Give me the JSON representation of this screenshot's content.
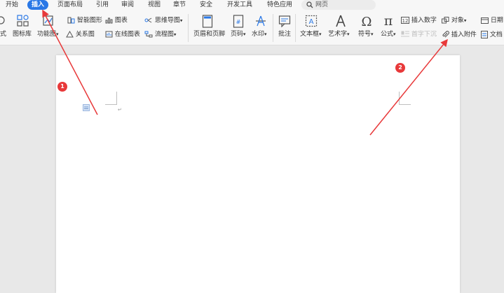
{
  "menu": {
    "tabs": [
      "开始",
      "插入",
      "页面布局",
      "引用",
      "审阅",
      "视图",
      "章节",
      "安全",
      "开发工具",
      "特色应用"
    ],
    "active_tab": "插入",
    "search_placeholder": "网页"
  },
  "ribbon": {
    "style_label": "式",
    "icon_library": "图标库",
    "function_chart": "功能图",
    "smart_shape": "智能图形",
    "relation_chart": "关系图",
    "chart": "图表",
    "online_chart": "在线图表",
    "mind_map": "思维导图",
    "flowchart": "流程图",
    "header_footer": "页眉和页脚",
    "page_number": "页码",
    "watermark": "水印",
    "comment": "批注",
    "text_box": "文本框",
    "word_art": "艺术字",
    "symbol": "符号",
    "formula": "公式",
    "insert_number": "插入数字",
    "object": "对象",
    "drop_cap": "首字下沉",
    "insert_attachment": "插入附件",
    "date": "日期",
    "document": "文档"
  },
  "annotations": {
    "badge1": "1",
    "badge2": "2"
  },
  "colors": {
    "accent": "#2a78e6",
    "annotation_red": "#e8393a"
  }
}
